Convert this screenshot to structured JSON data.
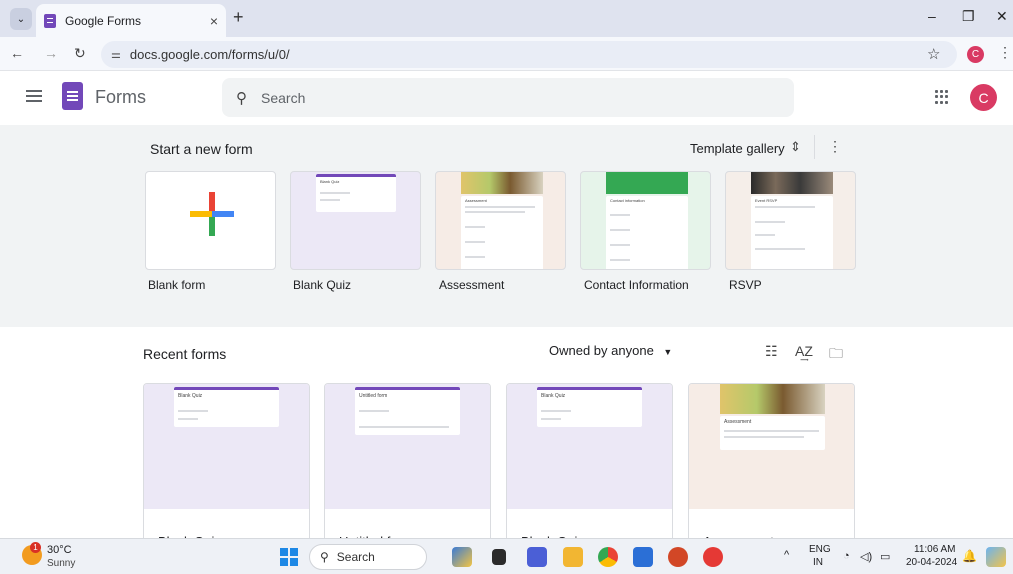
{
  "browser": {
    "tab_title": "Google Forms",
    "tab_close": "×",
    "new_tab": "+",
    "url": "docs.google.com/forms/u/0/",
    "window_controls": [
      "–",
      "❐",
      "✕"
    ],
    "profile_initial": "C"
  },
  "app": {
    "name": "Forms",
    "search_placeholder": "Search",
    "avatar_initial": "C"
  },
  "templates": {
    "section_title": "Start a new form",
    "gallery_label": "Template gallery",
    "items": [
      {
        "label": "Blank form"
      },
      {
        "label": "Blank Quiz",
        "thumb_title": "Blank Quiz"
      },
      {
        "label": "Assessment",
        "thumb_title": "Assessment"
      },
      {
        "label": "Contact Information",
        "thumb_title": "Contact information"
      },
      {
        "label": "RSVP",
        "thumb_title": "Event RSVP"
      }
    ]
  },
  "recent": {
    "section_title": "Recent forms",
    "owner_filter": "Owned by anyone",
    "items": [
      {
        "name": "Blank Quiz",
        "thumb_title": "Blank Quiz"
      },
      {
        "name": "Untitled form",
        "thumb_title": "Untitled form"
      },
      {
        "name": "Blank Quiz",
        "thumb_title": "Blank Quiz"
      },
      {
        "name": "Assessment",
        "thumb_title": "Assessment"
      }
    ]
  },
  "taskbar": {
    "weather_temp": "30°C",
    "weather_condition": "Sunny",
    "weather_badge": "1",
    "search_label": "Search",
    "lang_top": "ENG",
    "lang_bottom": "IN",
    "time": "11:06 AM",
    "date": "20-04-2024"
  },
  "colors": {
    "forms_purple": "#7248b9",
    "avatar": "#d93a63",
    "template_bg": "#f1f3f4",
    "quiz_thumb": "#ece8f6",
    "contact_green": "#34a853"
  }
}
